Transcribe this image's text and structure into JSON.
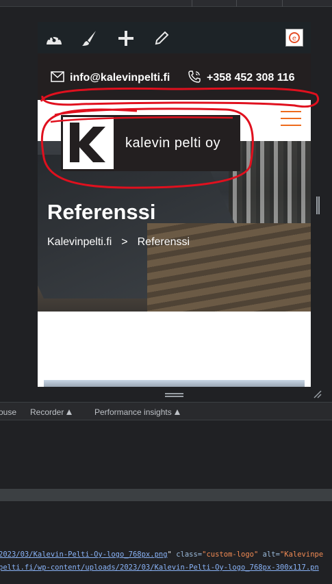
{
  "contact": {
    "email": "info@kalevinpelti.fi",
    "phone": "+358 452 308 116"
  },
  "logo": {
    "text": "kalevin pelti oy"
  },
  "hero": {
    "title": "Referenssi",
    "breadcrumb": {
      "home": "Kalevinpelti.fi",
      "separator": ">",
      "current": "Referenssi"
    }
  },
  "devtools": {
    "tabs": [
      "ouse",
      "Recorder",
      "Performance insights"
    ]
  },
  "console": {
    "line1": {
      "link": "2023/03/Kalevin-Pelti-Oy-logo_768px.png",
      "after_link": "\" ",
      "attr1": "class=",
      "val1": "\"custom-logo\"",
      "attr2": " alt=",
      "val2": "\"Kalevinpe"
    },
    "line2": {
      "link": "pelti.fi/wp-content/uploads/2023/03/Kalevin-Pelti-Oy-logo_768px-300x117.pn"
    }
  },
  "colors": {
    "accent": "#ee6a1b",
    "annotation": "#e0101e",
    "brand_dark": "#231f20"
  }
}
